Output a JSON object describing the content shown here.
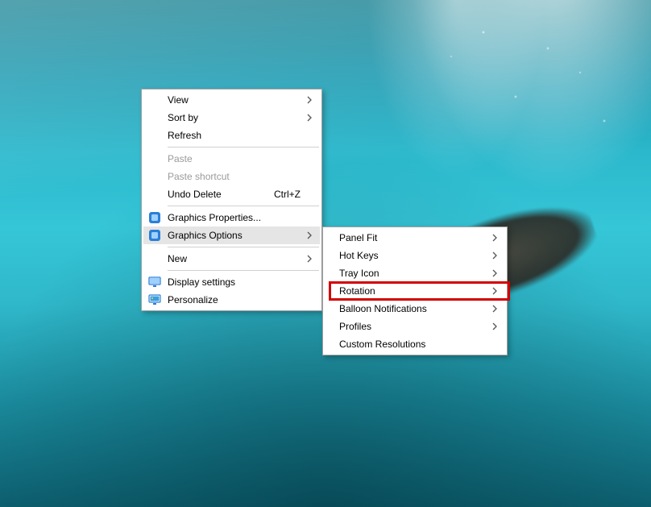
{
  "context_menu": {
    "items": [
      {
        "label": "View",
        "submenu": true,
        "enabled": true
      },
      {
        "label": "Sort by",
        "submenu": true,
        "enabled": true
      },
      {
        "label": "Refresh",
        "submenu": false,
        "enabled": true
      },
      {
        "separator": true
      },
      {
        "label": "Paste",
        "submenu": false,
        "enabled": false
      },
      {
        "label": "Paste shortcut",
        "submenu": false,
        "enabled": false
      },
      {
        "label": "Undo Delete",
        "submenu": false,
        "enabled": true,
        "shortcut": "Ctrl+Z"
      },
      {
        "separator": true
      },
      {
        "label": "Graphics Properties...",
        "submenu": false,
        "enabled": true,
        "icon": "intel-icon"
      },
      {
        "label": "Graphics Options",
        "submenu": true,
        "enabled": true,
        "icon": "intel-icon",
        "highlighted": true
      },
      {
        "separator": true
      },
      {
        "label": "New",
        "submenu": true,
        "enabled": true
      },
      {
        "separator": true
      },
      {
        "label": "Display settings",
        "submenu": false,
        "enabled": true,
        "icon": "display-icon"
      },
      {
        "label": "Personalize",
        "submenu": false,
        "enabled": true,
        "icon": "personalize-icon"
      }
    ]
  },
  "graphics_submenu": {
    "items": [
      {
        "label": "Panel Fit",
        "submenu": true
      },
      {
        "label": "Hot Keys",
        "submenu": true
      },
      {
        "label": "Tray Icon",
        "submenu": true
      },
      {
        "label": "Rotation",
        "submenu": true,
        "outlined": true
      },
      {
        "label": "Balloon Notifications",
        "submenu": true
      },
      {
        "label": "Profiles",
        "submenu": true
      },
      {
        "label": "Custom Resolutions",
        "submenu": false
      }
    ]
  }
}
